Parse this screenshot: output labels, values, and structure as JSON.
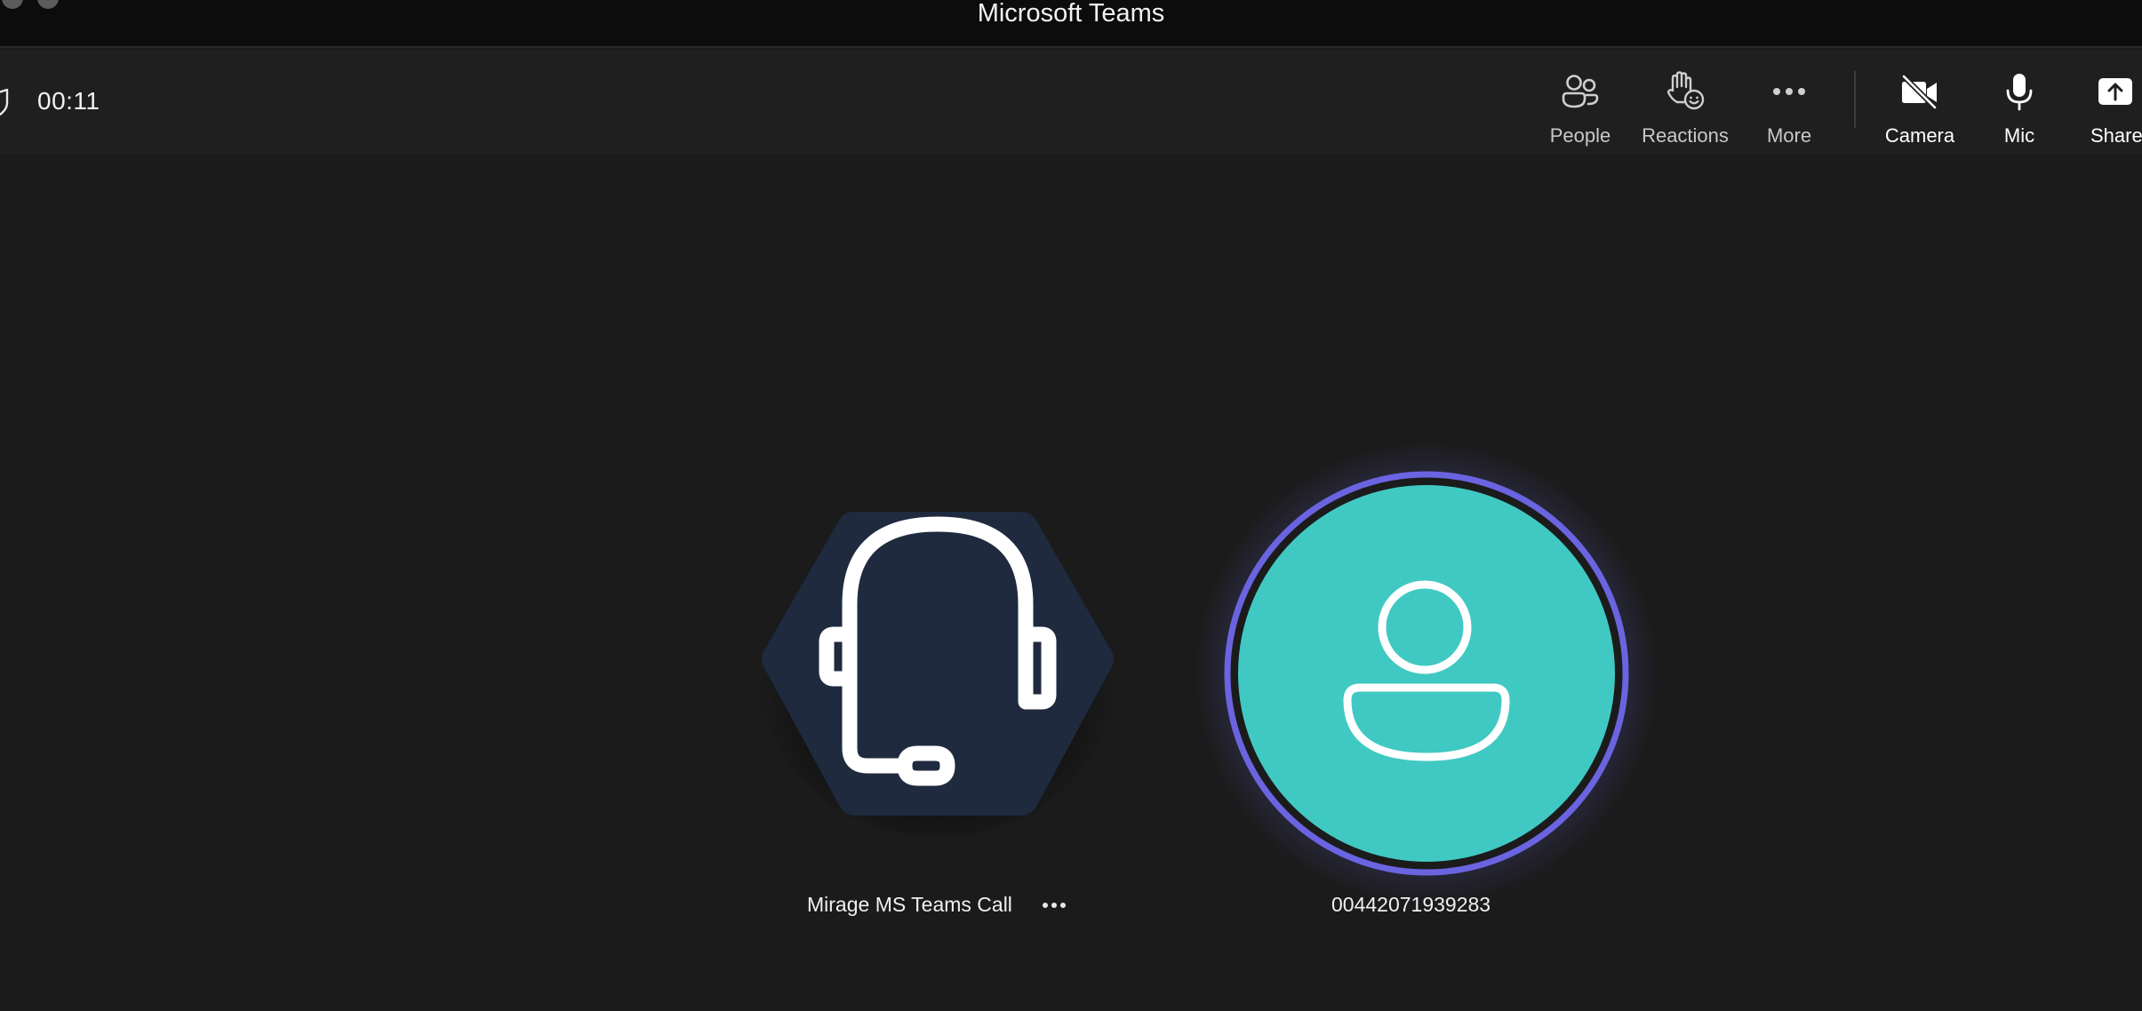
{
  "window": {
    "title": "Microsoft Teams"
  },
  "meeting": {
    "timer": "00:11"
  },
  "toolbar": {
    "items": [
      {
        "id": "people",
        "label": "People",
        "icon": "people-icon"
      },
      {
        "id": "reactions",
        "label": "Reactions",
        "icon": "raised-hand-reaction-icon"
      },
      {
        "id": "more",
        "label": "More",
        "icon": "ellipsis-icon"
      },
      {
        "id": "camera",
        "label": "Camera",
        "icon": "camera-off-icon"
      },
      {
        "id": "mic",
        "label": "Mic",
        "icon": "microphone-icon"
      },
      {
        "id": "share",
        "label": "Share",
        "icon": "share-screen-icon"
      }
    ]
  },
  "participants": [
    {
      "name": "Mirage MS Teams Call",
      "avatar": "headset-icon",
      "avatar_color": "#1f2a3e",
      "shape": "hexagon"
    },
    {
      "name": "00442071939283",
      "avatar": "person-icon",
      "avatar_color": "#40c9c2",
      "ring_color": "#6b64e0",
      "shape": "circle"
    }
  ],
  "colors": {
    "background": "#1b1b1b",
    "titlebar": "#0c0c0c",
    "toolbar": "#1f1f1f",
    "speaking_ring": "#6b64e0",
    "avatar_teal": "#40c9c2",
    "avatar_navy": "#1f2a3e"
  }
}
